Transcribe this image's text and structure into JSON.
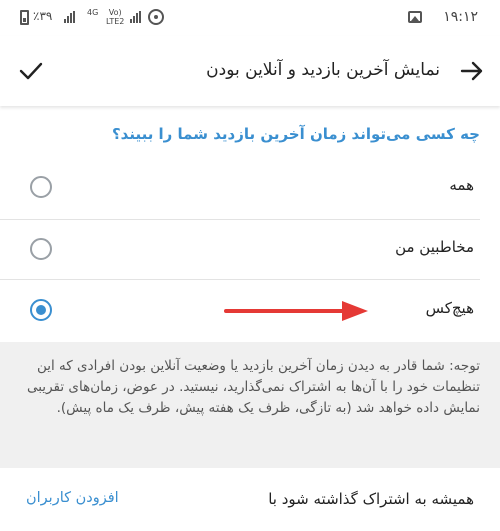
{
  "status_bar": {
    "time": "۱۹:۱۲",
    "battery_percent": "٪۳۹",
    "network_label_top": "4G",
    "network_label_mid": "Vo)",
    "network_label_bottom": "LTE2",
    "icons": [
      "battery-icon",
      "signal-icon",
      "hotspot-icon",
      "gallery-icon"
    ]
  },
  "app_bar": {
    "title": "نمایش آخرین بازدید و آنلاین بودن",
    "back_icon": "arrow-right-icon",
    "confirm_icon": "checkmark-icon"
  },
  "section": {
    "title": "چه کسی می‌تواند زمان آخرین بازدید شما را ببیند؟",
    "options": [
      {
        "label": "همه",
        "selected": false
      },
      {
        "label": "مخاطبین من",
        "selected": false
      },
      {
        "label": "هیچ‌کس",
        "selected": true
      }
    ]
  },
  "note": {
    "text": "توجه: شما قادر به دیدن زمان آخرین بازدید یا وضعیت آنلاین بودن افرادی که این تنظیمات خود را با آن‌ها به اشتراک نمی‌گذارید، نیستید. در عوض، زمان‌های تقریبی نمایش داده خواهد شد (به تازگی، ظرف یک هفته پیش، ظرف یک ماه پیش)."
  },
  "always_share": {
    "label": "همیشه به اشتراک گذاشته شود با",
    "action": "افزودن کاربران"
  },
  "colors": {
    "accent": "#3a8fd0",
    "annotation_arrow": "#e53935",
    "note_background": "#f0f0f0"
  }
}
